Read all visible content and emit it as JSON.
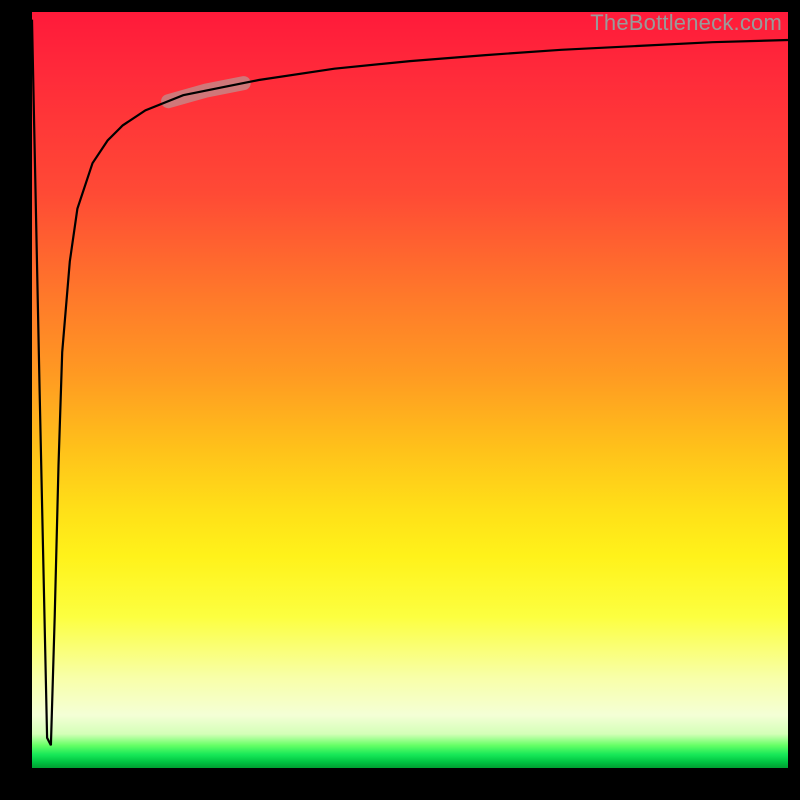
{
  "watermark": "TheBottleneck.com",
  "colors": {
    "background": "#000000",
    "gradient_top": "#ff1a3a",
    "gradient_bottom": "#00aa33",
    "curve": "#000000",
    "highlight": "#c48a8a",
    "watermark_text": "#9a9a9a"
  },
  "chart_data": {
    "type": "line",
    "title": "",
    "xlabel": "",
    "ylabel": "",
    "xlim": [
      0,
      100
    ],
    "ylim": [
      0,
      100
    ],
    "grid": false,
    "legend": null,
    "annotations": [
      {
        "text": "TheBottleneck.com",
        "position": "top-right"
      }
    ],
    "series": [
      {
        "name": "bottleneck-curve",
        "x": [
          0,
          1,
          2,
          2.5,
          3,
          3.5,
          4,
          5,
          6,
          8,
          10,
          12,
          15,
          20,
          25,
          30,
          40,
          50,
          60,
          70,
          80,
          90,
          100
        ],
        "values": [
          99,
          50,
          4,
          3,
          20,
          40,
          55,
          67,
          74,
          80,
          83,
          85,
          87,
          89,
          90,
          91,
          92.5,
          93.5,
          94.3,
          95,
          95.5,
          96,
          96.3
        ]
      }
    ],
    "highlight_segment": {
      "series": "bottleneck-curve",
      "x_start": 18,
      "x_end": 28
    },
    "background_gradient": {
      "direction": "vertical",
      "stops": [
        {
          "pos": 0.0,
          "color": "#ff1a3a"
        },
        {
          "pos": 0.45,
          "color": "#ff9a22"
        },
        {
          "pos": 0.72,
          "color": "#fff21a"
        },
        {
          "pos": 0.93,
          "color": "#f4ffd6"
        },
        {
          "pos": 1.0,
          "color": "#00aa33"
        }
      ]
    }
  }
}
